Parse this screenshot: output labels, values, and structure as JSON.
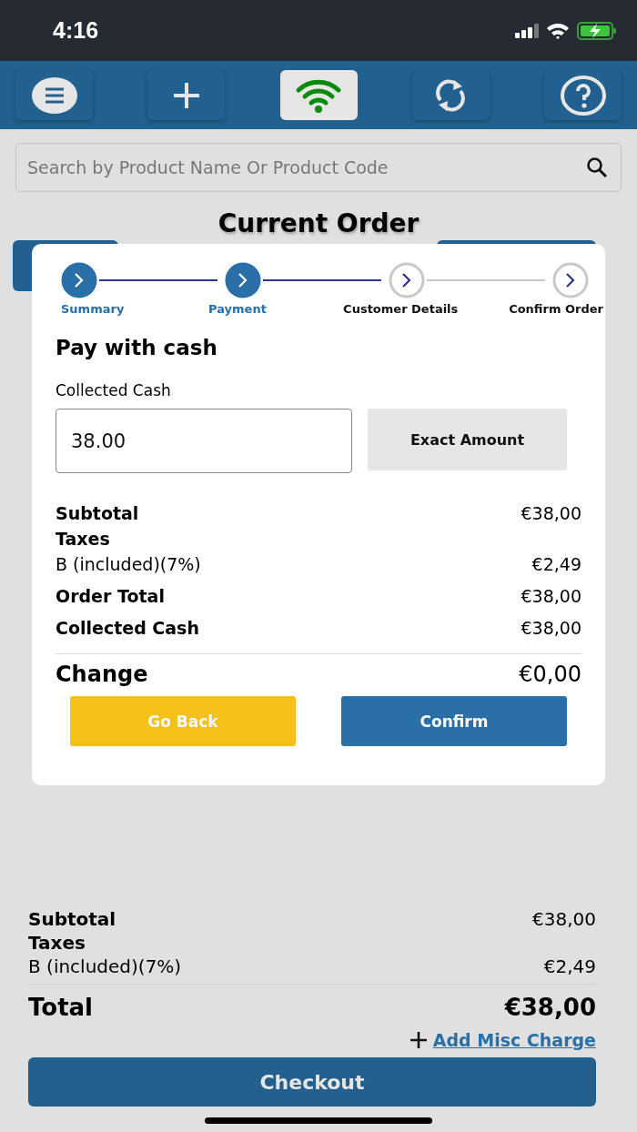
{
  "status_bar": {
    "time": "4:16"
  },
  "toolbar": {
    "buttons": [
      {
        "kind": "menu",
        "selected": false
      },
      {
        "kind": "add",
        "selected": false
      },
      {
        "kind": "wifi",
        "selected": true
      },
      {
        "kind": "sync",
        "selected": false
      },
      {
        "kind": "help",
        "selected": false
      }
    ]
  },
  "search": {
    "placeholder": "Search by Product Name Or Product Code"
  },
  "title": "Current Order",
  "totals": {
    "rows": [
      {
        "kind": "bold",
        "label": "Subtotal",
        "value": "€38,00"
      },
      {
        "kind": "bold",
        "label": "Taxes",
        "value": ""
      },
      {
        "kind": "plain",
        "label": "B (included)(7%)",
        "value": "€2,49"
      }
    ],
    "total": {
      "label": "Total",
      "value": "€38,00"
    },
    "add_link": "Add Misc Charge",
    "checkout": "Checkout"
  },
  "modal": {
    "steps": [
      {
        "label": "Summary",
        "completed": true
      },
      {
        "label": "Payment",
        "completed": true
      },
      {
        "label": "Customer Details",
        "completed": false
      },
      {
        "label": "Confirm Order",
        "completed": false
      }
    ],
    "heading": "Pay with cash",
    "field_label": "Collected Cash",
    "field_value": "38.00",
    "exact_button": "Exact Amount",
    "rows": [
      {
        "kind": "bold",
        "label": "Subtotal",
        "value": "€38,00"
      },
      {
        "kind": "bold",
        "label": "Taxes",
        "value": ""
      },
      {
        "kind": "plain",
        "label": "B (included)(7%)",
        "value": "€2,49"
      },
      {
        "kind": "bold",
        "label": "Order Total",
        "value": "€38,00"
      },
      {
        "kind": "bold",
        "label": "Collected Cash",
        "value": "€38,00"
      }
    ],
    "change": {
      "label": "Change",
      "value": "€0,00"
    },
    "back_button": "Go Back",
    "confirm_button": "Confirm"
  }
}
